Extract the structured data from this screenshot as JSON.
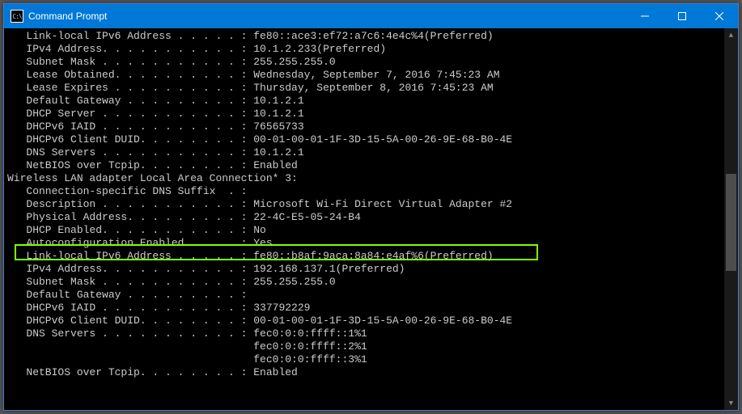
{
  "window": {
    "title": "Command Prompt"
  },
  "block1": [
    "   Link-local IPv6 Address . . . . . : fe80::ace3:ef72:a7c6:4e4c%4(Preferred)",
    "   IPv4 Address. . . . . . . . . . . : 10.1.2.233(Preferred)",
    "   Subnet Mask . . . . . . . . . . . : 255.255.255.0",
    "   Lease Obtained. . . . . . . . . . : Wednesday, September 7, 2016 7:45:23 AM",
    "   Lease Expires . . . . . . . . . . : Thursday, September 8, 2016 7:45:23 AM",
    "   Default Gateway . . . . . . . . . : 10.1.2.1",
    "   DHCP Server . . . . . . . . . . . : 10.1.2.1",
    "   DHCPv6 IAID . . . . . . . . . . . : 76565733",
    "   DHCPv6 Client DUID. . . . . . . . : 00-01-00-01-1F-3D-15-5A-00-26-9E-68-B0-4E",
    "   DNS Servers . . . . . . . . . . . : 10.1.2.1",
    "   NetBIOS over Tcpip. . . . . . . . : Enabled"
  ],
  "header2": "Wireless LAN adapter Local Area Connection* 3:",
  "block2a": [
    "   Connection-specific DNS Suffix  . :",
    "   Description . . . . . . . . . . . : Microsoft Wi-Fi Direct Virtual Adapter #2"
  ],
  "highlighted": "   Physical Address. . . . . . . . . : 22-4C-E5-05-24-B4",
  "block2b": [
    "   DHCP Enabled. . . . . . . . . . . : No",
    "   Autoconfiguration Enabled . . . . : Yes",
    "   Link-local IPv6 Address . . . . . : fe80::b8af:9aca:8a84:e4af%6(Preferred)",
    "   IPv4 Address. . . . . . . . . . . : 192.168.137.1(Preferred)",
    "   Subnet Mask . . . . . . . . . . . : 255.255.255.0",
    "   Default Gateway . . . . . . . . . :",
    "   DHCPv6 IAID . . . . . . . . . . . : 337792229",
    "   DHCPv6 Client DUID. . . . . . . . : 00-01-00-01-1F-3D-15-5A-00-26-9E-68-B0-4E",
    "   DNS Servers . . . . . . . . . . . : fec0:0:0:ffff::1%1",
    "                                       fec0:0:0:ffff::2%1",
    "                                       fec0:0:0:ffff::3%1",
    "   NetBIOS over Tcpip. . . . . . . . : Enabled"
  ]
}
